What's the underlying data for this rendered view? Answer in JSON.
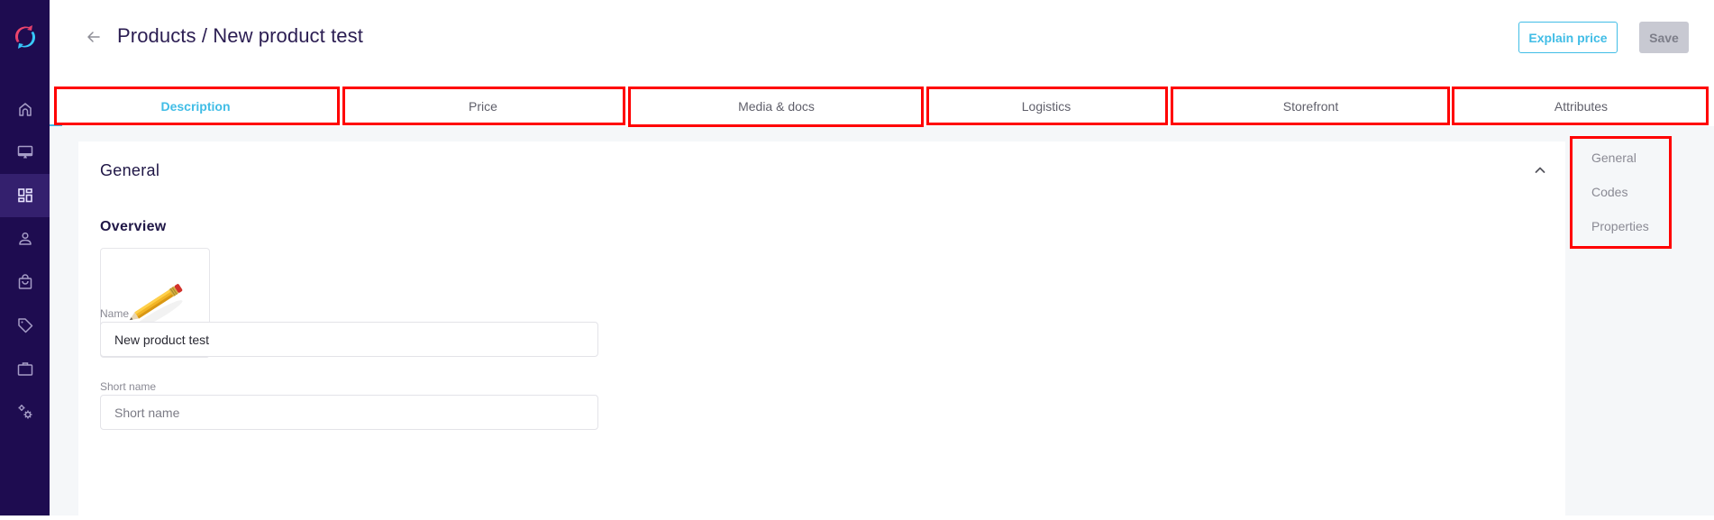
{
  "app": {
    "logo_icon": "app-logo-refresh-icon",
    "colors": {
      "sidebar_bg": "#1e0c50",
      "sidebar_active": "#34206e",
      "accent": "#41bde6",
      "annotation": "#ff0000"
    }
  },
  "sidebar": {
    "items": [
      {
        "icon": "home-icon",
        "label": "Home",
        "active": false
      },
      {
        "icon": "monitor-icon",
        "label": "Dashboard",
        "active": false
      },
      {
        "icon": "grid-icon",
        "label": "Products",
        "active": true
      },
      {
        "icon": "user-icon",
        "label": "Customers",
        "active": false
      },
      {
        "icon": "shopping-bag-icon",
        "label": "Orders",
        "active": false
      },
      {
        "icon": "tag-icon",
        "label": "Promotions",
        "active": false
      },
      {
        "icon": "briefcase-icon",
        "label": "Business",
        "active": false
      },
      {
        "icon": "settings-icon",
        "label": "Settings",
        "active": false
      }
    ]
  },
  "header": {
    "back_icon": "arrow-left-icon",
    "title": "Products / New product test",
    "explain_price_label": "Explain price",
    "save_label": "Save"
  },
  "tabs": [
    {
      "label": "Description",
      "active": true
    },
    {
      "label": "Price",
      "active": false
    },
    {
      "label": "Media & docs",
      "active": false
    },
    {
      "label": "Logistics",
      "active": false
    },
    {
      "label": "Storefront",
      "active": false
    },
    {
      "label": "Attributes",
      "active": false
    }
  ],
  "card": {
    "title": "General",
    "collapse_icon": "chevron-up-icon",
    "section_title": "Overview",
    "image_icon": "pencil-image",
    "fields": [
      {
        "label": "Name",
        "value": "New product test",
        "placeholder": "Name"
      },
      {
        "label": "Short name",
        "value": "",
        "placeholder": "Short name"
      }
    ]
  },
  "side_nav": {
    "links": [
      "General",
      "Codes",
      "Properties"
    ]
  }
}
